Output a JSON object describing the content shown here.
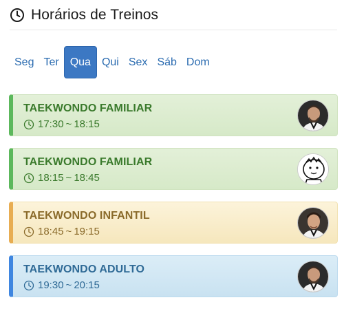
{
  "header": {
    "title": "Horários de Treinos",
    "icon": "clock-icon"
  },
  "tabs": [
    {
      "label": "Seg",
      "active": false
    },
    {
      "label": "Ter",
      "active": false
    },
    {
      "label": "Qua",
      "active": true
    },
    {
      "label": "Qui",
      "active": false
    },
    {
      "label": "Sex",
      "active": false
    },
    {
      "label": "Sáb",
      "active": false
    },
    {
      "label": "Dom",
      "active": false
    }
  ],
  "classes": [
    {
      "name": "TAEKWONDO FAMILIAR",
      "start": "17:30",
      "end": "18:15",
      "color": "#5cb85c",
      "avatar": "instructor-photo"
    },
    {
      "name": "TAEKWONDO FAMILIAR",
      "start": "18:15",
      "end": "18:45",
      "color": "#5cb85c",
      "avatar": "cartoon-kid"
    },
    {
      "name": "TAEKWONDO INFANTIL",
      "start": "18:45",
      "end": "19:15",
      "color": "#e8ad52",
      "avatar": "instructor-photo"
    },
    {
      "name": "TAEKWONDO ADULTO",
      "start": "19:30",
      "end": "20:15",
      "color": "#3f86e0",
      "avatar": "instructor-photo"
    }
  ],
  "time_separator": "~"
}
